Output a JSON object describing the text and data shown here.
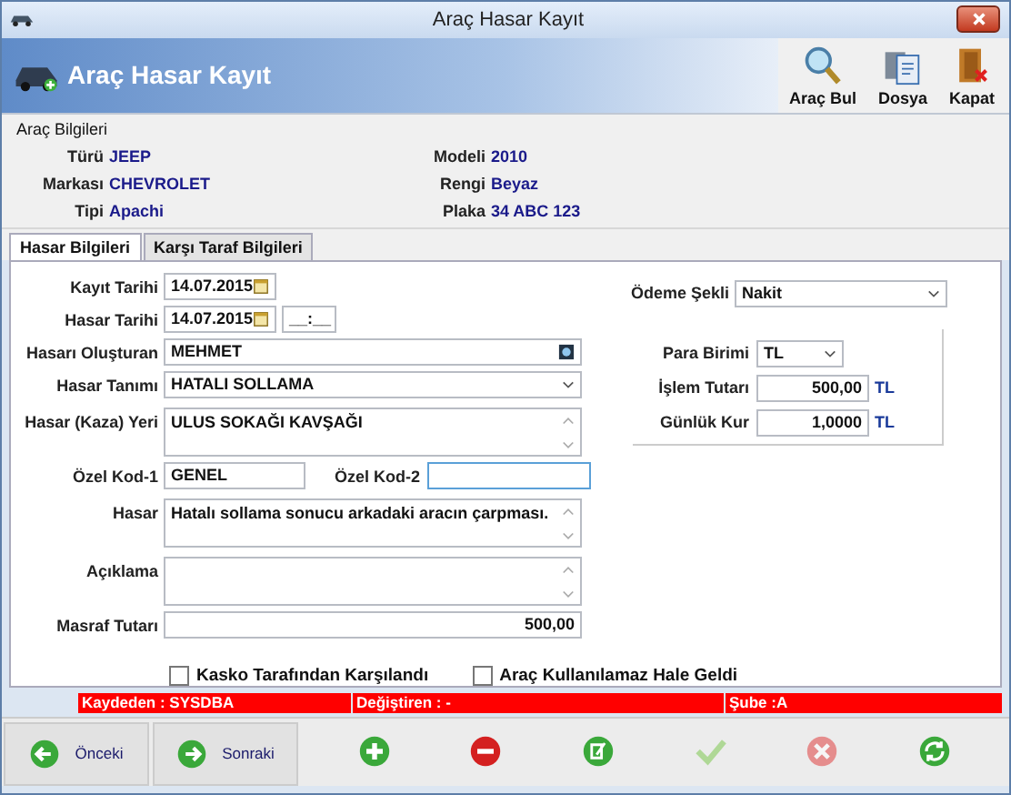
{
  "window": {
    "title": "Araç Hasar Kayıt"
  },
  "header": {
    "title": "Araç Hasar Kayıt",
    "tools": [
      {
        "label": "Araç Bul",
        "kind": "search"
      },
      {
        "label": "Dosya",
        "kind": "file"
      },
      {
        "label": "Kapat",
        "kind": "exit"
      }
    ]
  },
  "vehicle": {
    "title": "Araç Bilgileri",
    "fields": [
      {
        "label": "Türü",
        "value": "JEEP"
      },
      {
        "label": "Modeli",
        "value": "2010"
      },
      {
        "label": "Markası",
        "value": "CHEVROLET"
      },
      {
        "label": "Rengi",
        "value": "Beyaz"
      },
      {
        "label": "Tipi",
        "value": "Apachi"
      },
      {
        "label": "Plaka",
        "value": "34 ABC 123"
      }
    ]
  },
  "tabs": [
    {
      "label": "Hasar Bilgileri",
      "selected": true
    },
    {
      "label": "Karşı Taraf Bilgileri",
      "selected": false
    }
  ],
  "form": [
    {
      "kind": "date",
      "label": "Kayıt Tarihi",
      "value": "14.07.2015"
    },
    {
      "kind": "date",
      "label": "Hasar Tarihi",
      "value": "14.07.2015",
      "time": "__:__"
    },
    {
      "kind": "lookup",
      "label": "Hasarı Oluşturan",
      "value": "MEHMET"
    },
    {
      "kind": "select",
      "label": "Hasar Tanımı",
      "value": "HATALI SOLLAMA"
    },
    {
      "kind": "memo",
      "label": "Hasar (Kaza) Yeri",
      "value": "ULUS SOKAĞI KAVŞAĞI"
    },
    {
      "kind": "pair",
      "label": "Özel Kod-1",
      "value": "GENEL",
      "label2": "Özel Kod-2",
      "focused": true
    },
    {
      "kind": "memo",
      "label": "Hasar",
      "value": "Hatalı sollama sonucu arkadaki aracın çarpması."
    },
    {
      "kind": "memo",
      "label": "Açıklama"
    },
    {
      "kind": "amount",
      "label": "Masraf Tutarı",
      "value": "500,00"
    }
  ],
  "checkboxes": [
    {
      "label": "Kasko Tarafından Karşılandı",
      "checked": false
    },
    {
      "label": "Araç Kullanılamaz Hale Geldi",
      "checked": false
    }
  ],
  "payment": {
    "label": "Ödeme Şekli",
    "value": "Nakit"
  },
  "currency": [
    {
      "kind": "select",
      "label": "Para Birimi",
      "value": "TL"
    },
    {
      "kind": "amount",
      "label": "İşlem Tutarı",
      "value": "500,00",
      "unit": "TL"
    },
    {
      "kind": "amount",
      "label": "Günlük Kur",
      "value": "1,0000",
      "unit": "TL"
    }
  ],
  "status": [
    "Kaydeden : SYSDBA",
    "Değiştiren :  -",
    "Şube :A"
  ],
  "nav": [
    {
      "label": "Önceki",
      "kind": "prev"
    },
    {
      "label": "Sonraki",
      "kind": "next"
    }
  ],
  "actions": [
    {
      "kind": "add",
      "disabled": false
    },
    {
      "kind": "delete",
      "disabled": false
    },
    {
      "kind": "edit",
      "disabled": false
    },
    {
      "kind": "save",
      "disabled": true
    },
    {
      "kind": "cancel",
      "disabled": true
    },
    {
      "kind": "refresh",
      "disabled": false
    }
  ]
}
